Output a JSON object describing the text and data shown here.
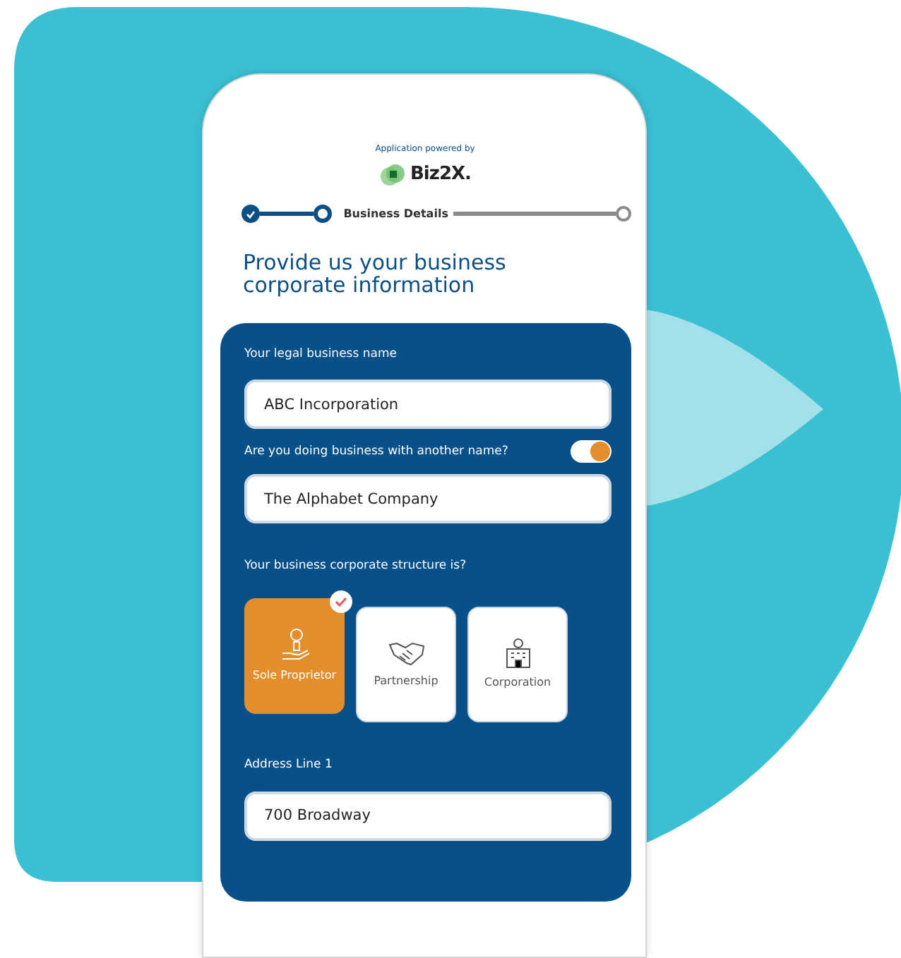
{
  "header": {
    "powered_by": "Application powered by",
    "brand": "Biz2X."
  },
  "stepper": [
    {
      "done": true,
      "selected": false
    },
    {
      "done": false,
      "selected": true,
      "label": "Business Details"
    },
    {
      "done": false,
      "selected": false
    }
  ],
  "title": "Provide us your business corporate information",
  "form": {
    "legal_name": {
      "label": "Your legal business name",
      "value": "ABC Incorporation"
    },
    "dba": {
      "label": "Are you doing business with another name?",
      "on": true,
      "value": "The Alphabet Company"
    },
    "structure": {
      "label": "Your business corporate structure is?",
      "options": [
        {
          "kind": "sole",
          "label": "Sole Proprietor",
          "selected": true
        },
        {
          "kind": "partnership",
          "label": "Partnership",
          "selected": false
        },
        {
          "kind": "corporation",
          "label": "Corporation",
          "selected": false
        }
      ]
    },
    "address": {
      "label": "Address Line 1",
      "value": "700 Broadway"
    }
  }
}
